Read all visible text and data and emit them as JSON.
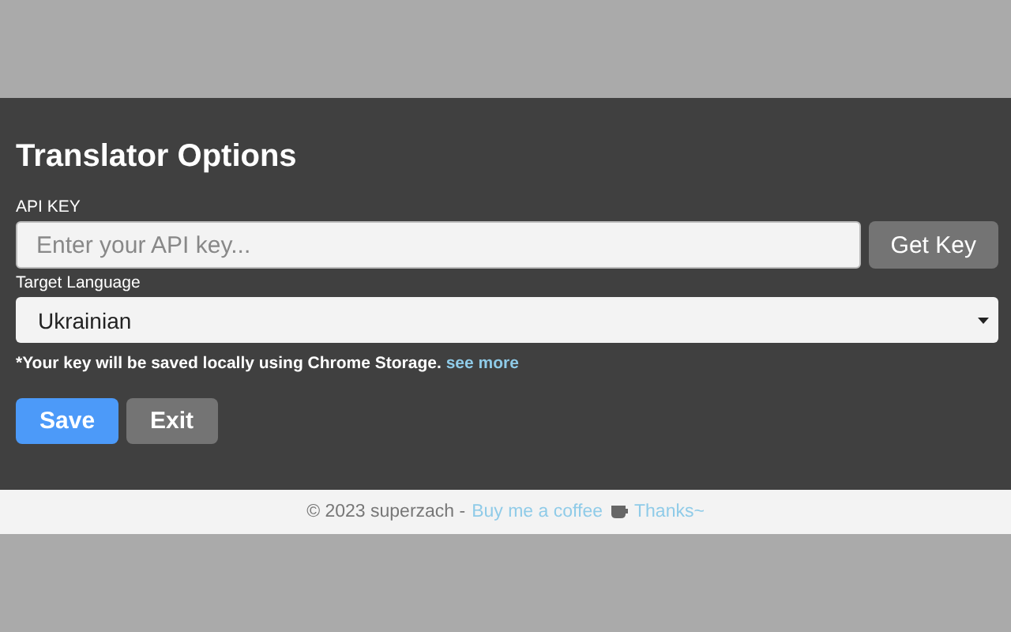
{
  "title": "Translator Options",
  "api_key": {
    "label": "API KEY",
    "placeholder": "Enter your API key...",
    "button": "Get Key"
  },
  "target_language": {
    "label": "Target Language",
    "value": "Ukrainian"
  },
  "note": {
    "text": "*Your key will be saved locally using Chrome Storage.",
    "link": "see more"
  },
  "buttons": [
    {
      "kind": "primary",
      "label": "Save"
    },
    {
      "kind": "secondary",
      "label": "Exit"
    }
  ],
  "footer": {
    "text": "© 2023 superzach -",
    "link": "Buy me a coffee",
    "thanks": "Thanks~"
  }
}
